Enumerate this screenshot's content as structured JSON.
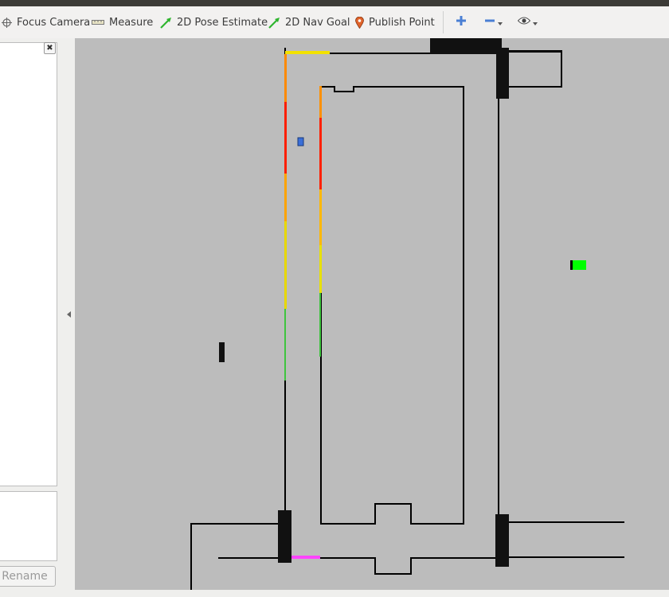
{
  "toolbar": {
    "tools": [
      {
        "id": "focus-camera",
        "label": "Focus Camera",
        "icon": "crosshair-icon"
      },
      {
        "id": "measure",
        "label": "Measure",
        "icon": "ruler-icon"
      },
      {
        "id": "pose-estimate",
        "label": "2D Pose Estimate",
        "icon": "green-arrow-icon"
      },
      {
        "id": "nav-goal",
        "label": "2D Nav Goal",
        "icon": "green-arrow-icon"
      },
      {
        "id": "publish-point",
        "label": "Publish Point",
        "icon": "map-pin-icon"
      }
    ],
    "add_icon": "plus-icon",
    "remove_icon": "minus-icon",
    "view_icon": "eye-icon"
  },
  "left_panel": {
    "close_glyph": "✖",
    "rename_label": "Rename"
  },
  "colors": {
    "map_background": "#bcbcbc",
    "walls": "#000000",
    "laser_hot": "#ff2a00",
    "laser_warm": "#ffd800",
    "laser_cool": "#33cc33",
    "goal_marker": "#00ff00",
    "path_magenta": "#ff44ff",
    "robot_marker": "#3a6fd8"
  }
}
